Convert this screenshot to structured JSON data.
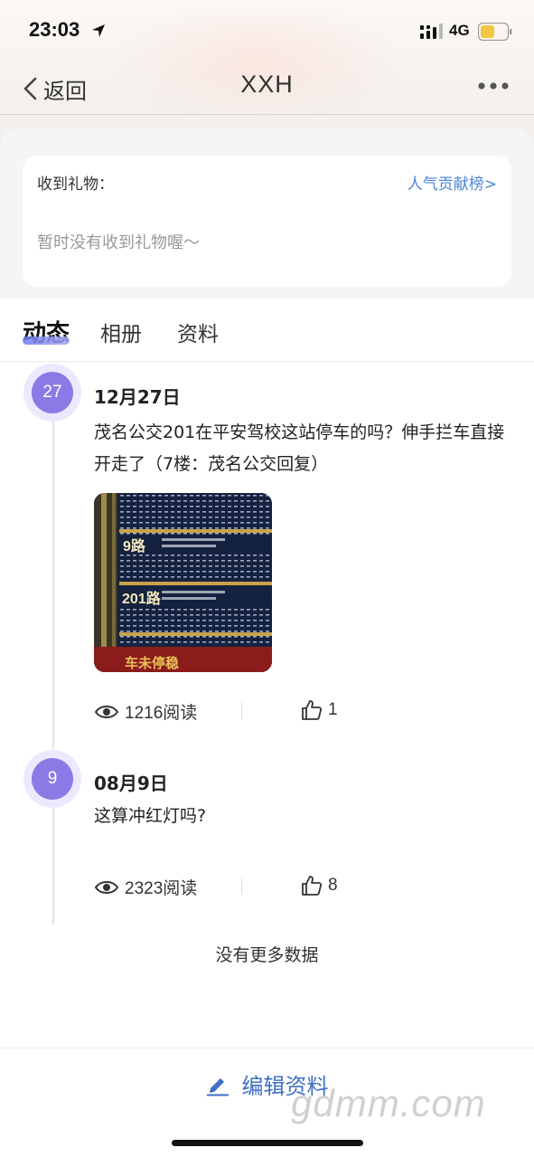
{
  "status_bar": {
    "time": "23:03",
    "network": "4G",
    "battery_color": "#f2c744"
  },
  "nav": {
    "back_label": "返回",
    "title": "XXH"
  },
  "gifts": {
    "title": "收到礼物：",
    "rank_link": "人气贡献榜>",
    "empty_text": "暂时没有收到礼物喔～"
  },
  "tabs": [
    {
      "label": "动态",
      "active": true
    },
    {
      "label": "相册",
      "active": false
    },
    {
      "label": "资料",
      "active": false
    }
  ],
  "posts": [
    {
      "day": "27",
      "date": "12月27日",
      "text": "茂名公交201在平安驾校这站停车的吗？伸手拦车直接开走了（7楼：茂名公交回复）",
      "image": {
        "route_a": "9路",
        "route_b": "201路",
        "footer": "车未停稳"
      },
      "reads": "1216阅读",
      "likes": "1"
    },
    {
      "day": "9",
      "date": "08月9日",
      "text": "这算冲红灯吗?",
      "reads": "2323阅读",
      "likes": "8"
    }
  ],
  "footer": {
    "no_more": "没有更多数据",
    "edit_label": "编辑资料",
    "watermark": "gdmm.com"
  },
  "colors": {
    "accent_purple": "#8b7ae6",
    "link_blue": "#4d86d6",
    "edit_blue": "#3f6fc4"
  }
}
